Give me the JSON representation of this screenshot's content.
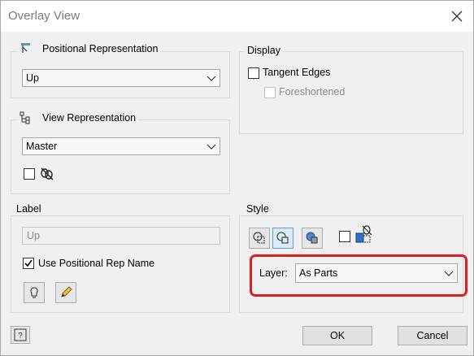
{
  "window": {
    "title": "Overlay View"
  },
  "positional": {
    "legend": "Positional Representation",
    "selected": "Up"
  },
  "view_rep": {
    "legend": "View Representation",
    "selected": "Master"
  },
  "display": {
    "legend": "Display",
    "tangent_edges": "Tangent Edges",
    "foreshortened": "Foreshortened"
  },
  "label": {
    "legend": "Label",
    "value": "Up",
    "use_rep_name": "Use Positional Rep Name"
  },
  "style": {
    "legend": "Style",
    "layer_label": "Layer:",
    "layer_value": "As Parts"
  },
  "buttons": {
    "ok": "OK",
    "cancel": "Cancel"
  },
  "colors": {
    "highlight": "#e02020",
    "accent": "#5a9be0"
  }
}
